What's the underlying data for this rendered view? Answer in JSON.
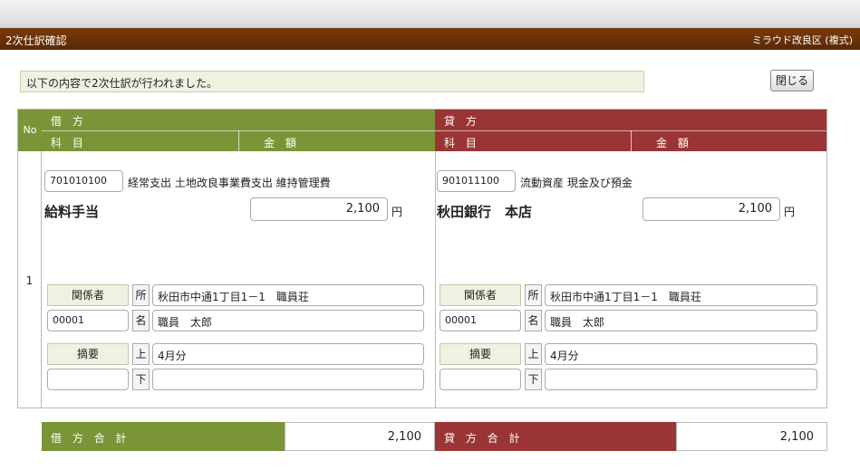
{
  "header": {
    "title": "2次仕訳確認",
    "org": "ミラウド改良区 (複式)"
  },
  "message": "以下の内容で2次仕訳が行われました。",
  "close_label": "閉じる",
  "columns": {
    "no": "No",
    "debit": "借 方",
    "credit": "貸 方",
    "subject": "科 目",
    "amount": "金 額"
  },
  "row": {
    "no": "1",
    "debit": {
      "code": "701010100",
      "account_name": "経常支出 土地改良事業費支出 維持管理費",
      "sub_account": "給料手当",
      "amount": "2,100",
      "unit": "円",
      "party_label": "関係者",
      "address_tag": "所",
      "address": "秋田市中通1丁目1－1　職員荘",
      "party_code": "00001",
      "name_tag": "名",
      "name": "職員　太郎",
      "memo_label": "摘要",
      "upper_tag": "上",
      "memo_upper": "4月分",
      "lower_tag": "下",
      "memo_lower": ""
    },
    "credit": {
      "code": "901011100",
      "account_name": "流動資産 現金及び預金",
      "sub_account": "秋田銀行　本店",
      "amount": "2,100",
      "unit": "円",
      "party_label": "関係者",
      "address_tag": "所",
      "address": "秋田市中通1丁目1－1　職員荘",
      "party_code": "00001",
      "name_tag": "名",
      "name": "職員　太郎",
      "memo_label": "摘要",
      "upper_tag": "上",
      "memo_upper": "4月分",
      "lower_tag": "下",
      "memo_lower": ""
    }
  },
  "totals": {
    "debit_label": "借 方 合 計",
    "debit_value": "2,100",
    "credit_label": "貸 方 合 計",
    "credit_value": "2,100"
  },
  "colors": {
    "title_bar": "#6b3108",
    "debit": "#7a9537",
    "credit": "#9b3535"
  }
}
